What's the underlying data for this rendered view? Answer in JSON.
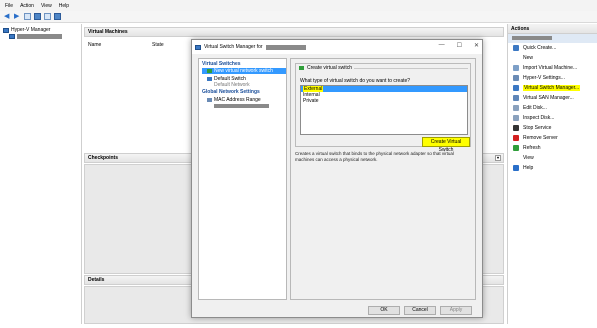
{
  "menu": [
    "File",
    "Action",
    "View",
    "Help"
  ],
  "tree": {
    "root": "Hyper-V Manager"
  },
  "center": {
    "vm_header": "Virtual Machines",
    "columns": [
      "Name",
      "State"
    ],
    "checkpoints_header": "Checkpoints",
    "details_header": "Details"
  },
  "actions": {
    "header": "Actions",
    "items": [
      {
        "label": "Quick Create...",
        "icon": "quick-create-icon",
        "color": "#3b78c3"
      },
      {
        "label": "New",
        "icon": "blank-icon",
        "color": "#ffffff"
      },
      {
        "label": "Import Virtual Machine...",
        "icon": "import-icon",
        "color": "#7d9fc7"
      },
      {
        "label": "Hyper-V Settings...",
        "icon": "settings-icon",
        "color": "#6a8bb5"
      },
      {
        "label": "Virtual Switch Manager...",
        "icon": "switch-icon",
        "color": "#3b78c3"
      },
      {
        "label": "Virtual SAN Manager...",
        "icon": "san-icon",
        "color": "#5f86b8"
      },
      {
        "label": "Edit Disk...",
        "icon": "disk-icon",
        "color": "#8aa1bd"
      },
      {
        "label": "Inspect Disk...",
        "icon": "inspect-icon",
        "color": "#8aa1bd"
      },
      {
        "label": "Stop Service",
        "icon": "stop-icon",
        "color": "#333333"
      },
      {
        "label": "Remove Server",
        "icon": "remove-icon",
        "color": "#d32020"
      },
      {
        "label": "Refresh",
        "icon": "refresh-icon",
        "color": "#2f9e3a"
      },
      {
        "label": "View",
        "icon": "blank-icon",
        "color": "#ffffff"
      },
      {
        "label": "Help",
        "icon": "help-icon",
        "color": "#2a6fc9"
      }
    ],
    "highlighted_item": "Virtual Switch Manager...",
    "highlight_color": "#ffff00"
  },
  "dialog": {
    "title": "Virtual Switch Manager for",
    "left": {
      "virtual_switches_header": "Virtual Switches",
      "new_switch": "New virtual network switch",
      "default_switch": "Default Switch",
      "default_network": "Default Network",
      "global_header": "Global Network Settings",
      "mac_range": "MAC Address Range"
    },
    "right": {
      "group_title": "Create virtual switch",
      "question": "What type of virtual switch do you want to create?",
      "types": [
        "External",
        "Internal",
        "Private"
      ],
      "selected_type": "External",
      "create_button": "Create Virtual Switch",
      "description": "Creates a virtual switch that binds to the physical network adapter so that virtual machines can access a physical network."
    },
    "buttons": {
      "ok": "OK",
      "cancel": "Cancel",
      "apply": "Apply"
    }
  }
}
